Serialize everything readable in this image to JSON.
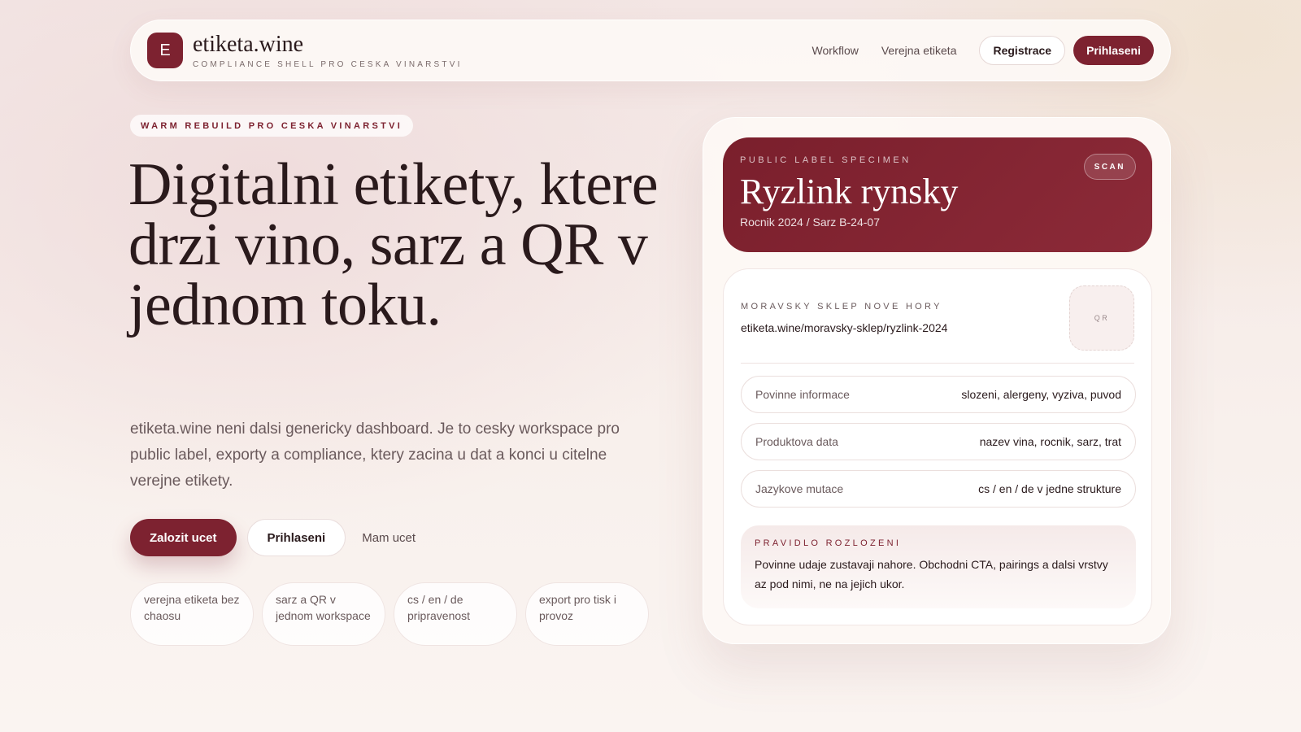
{
  "nav": {
    "logo_letter": "E",
    "brand_name": "etiketa.wine",
    "brand_tagline": "COMPLIANCE SHELL PRO CESKA VINARSTVI",
    "links": [
      {
        "label": "Workflow"
      },
      {
        "label": "Verejna etiketa"
      }
    ],
    "register_label": "Registrace",
    "login_label": "Prihlaseni"
  },
  "hero": {
    "eyebrow": "WARM REBUILD PRO CESKA VINARSTVI",
    "headline": "Digitalni etikety, ktere drzi vino, sarz a QR v jednom toku.",
    "lead": "etiketa.wine neni dalsi genericky dashboard. Je to cesky workspace pro public label, exporty a compliance, ktery zacina u dat a konci u citelne verejne etikety.",
    "cta_primary": "Zalozit ucet",
    "cta_secondary": "Prihlaseni",
    "cta_link": "Mam ucet",
    "pills": [
      {
        "text": "verejna etiketa bez chaosu"
      },
      {
        "text": "sarz a QR v jednom workspace"
      },
      {
        "text": "cs / en / de pripravenost"
      },
      {
        "text": "export pro tisk i provoz"
      }
    ]
  },
  "specimen": {
    "kicker": "PUBLIC LABEL SPECIMEN",
    "title": "Ryzlink rynsky",
    "subtitle": "Rocnik 2024 / Sarz B-24-07",
    "scan_label": "SCAN",
    "producer": "MORAVSKY SKLEP NOVE HORY",
    "url": "etiketa.wine/moravsky-sklep/ryzlink-2024",
    "qr_label": "QR",
    "rows": [
      {
        "key": "Povinne informace",
        "value": "slozeni, alergeny, vyziva, puvod"
      },
      {
        "key": "Produktova data",
        "value": "nazev vina, rocnik, sarz, trat"
      },
      {
        "key": "Jazykove mutace",
        "value": "cs / en / de v jedne strukture"
      }
    ],
    "rule_kicker": "PRAVIDLO ROZLOZENI",
    "rule_text": "Povinne udaje zustavaji nahore. Obchodni CTA, pairings a dalsi vrstvy az pod nimi, ne na jejich ukor."
  },
  "colors": {
    "accent": "#7d2230",
    "background": "#f5ebe8"
  }
}
